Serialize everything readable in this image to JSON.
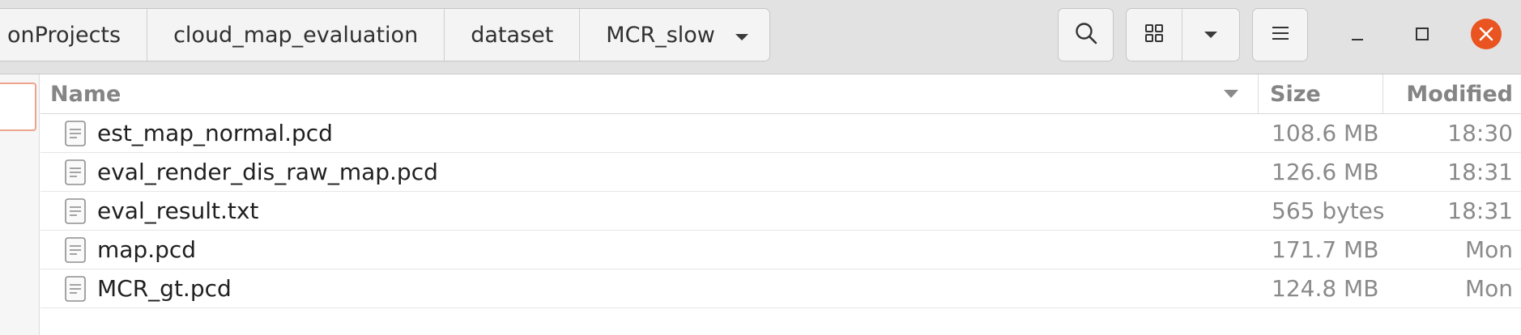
{
  "pathbar": {
    "crumbs": [
      "onProjects",
      "cloud_map_evaluation",
      "dataset",
      "MCR_slow"
    ]
  },
  "toolbar": {
    "icons": [
      "search-icon",
      "grid-view-icon",
      "chevron-down-icon",
      "hamburger-menu-icon"
    ]
  },
  "window": {
    "icons": [
      "minimize-icon",
      "maximize-icon",
      "close-icon"
    ],
    "close_color": "#e95420"
  },
  "columns": {
    "name": "Name",
    "size": "Size",
    "modified": "Modified"
  },
  "files": [
    {
      "name": "est_map_normal.pcd",
      "size": "108.6 MB",
      "modified": "18:30"
    },
    {
      "name": "eval_render_dis_raw_map.pcd",
      "size": "126.6 MB",
      "modified": "18:31"
    },
    {
      "name": "eval_result.txt",
      "size": "565 bytes",
      "modified": "18:31"
    },
    {
      "name": "map.pcd",
      "size": "171.7 MB",
      "modified": "Mon"
    },
    {
      "name": "MCR_gt.pcd",
      "size": "124.8 MB",
      "modified": "Mon"
    }
  ],
  "colors": {
    "header_bg": "#e2e2e2",
    "accent": "#e95420",
    "selection_border": "#eda48c"
  }
}
